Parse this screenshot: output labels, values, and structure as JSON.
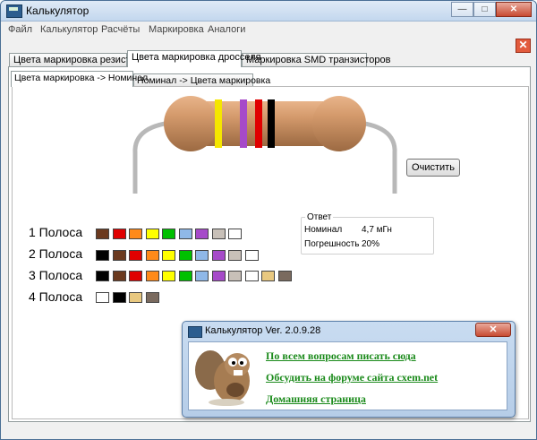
{
  "window": {
    "title": "Калькулятор",
    "minimize": "—",
    "maximize": "□",
    "close": "✕"
  },
  "menu": [
    "Файл",
    "Калькулятор",
    "Расчёты",
    "Маркировка",
    "Аналоги"
  ],
  "main_tabs": [
    "Цвета маркировка резистора",
    "Цвета маркировка дросселя",
    "Маркировка SMD транзисторов"
  ],
  "sub_tabs": [
    "Цвета маркировка -> Номинал",
    "Номинал -> Цвета маркировка"
  ],
  "close_glyph": "✕",
  "clear_button": "Очистить",
  "bands": [
    {
      "label": "1 Полоса",
      "colors": [
        "#6b3a1f",
        "#e00000",
        "#ff8a1a",
        "#ffff00",
        "#00c000",
        "#8fb8e8",
        "#a64ac9",
        "#c8c0b8",
        "#ffffff"
      ]
    },
    {
      "label": "2 Полоса",
      "colors": [
        "#000000",
        "#6b3a1f",
        "#e00000",
        "#ff8a1a",
        "#ffff00",
        "#00c000",
        "#8fb8e8",
        "#a64ac9",
        "#c8c0b8",
        "#ffffff"
      ]
    },
    {
      "label": "3 Полоса",
      "colors": [
        "#000000",
        "#6b3a1f",
        "#e00000",
        "#ff8a1a",
        "#ffff00",
        "#00c000",
        "#8fb8e8",
        "#a64ac9",
        "#c8c0b8",
        "#ffffff",
        "#e8c880",
        "#7a6a5e"
      ]
    },
    {
      "label": "4 Полоса",
      "colors": [
        "#ffffff",
        "#000000",
        "#e8c880",
        "#7a6a5e"
      ]
    }
  ],
  "answer": {
    "legend": "Ответ",
    "nominal_label": "Номинал",
    "nominal_value": "4,7 мГн",
    "tolerance_label": "Погрешность",
    "tolerance_value": "20%"
  },
  "inductor_bands": [
    "#f5e600",
    "#a64ac9",
    "#e00000",
    "#000000"
  ],
  "dialog": {
    "title": "Калькулятор Ver. 2.0.9.28",
    "close": "✕",
    "links": [
      "По всем вопросам писать сюда",
      "Обсудить на форуме сайта cxem.net",
      "Домашняя страница"
    ]
  }
}
